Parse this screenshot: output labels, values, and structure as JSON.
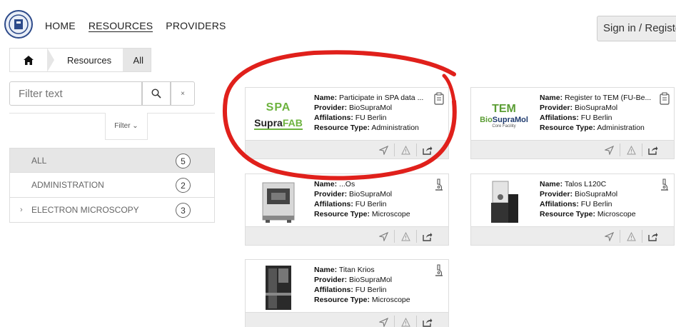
{
  "nav": {
    "items": [
      {
        "label": "HOME",
        "active": false
      },
      {
        "label": "RESOURCES",
        "active": true
      },
      {
        "label": "PROVIDERS",
        "active": false
      }
    ],
    "signin_label": "Sign in / Registe"
  },
  "breadcrumb": {
    "home_icon": "home-icon",
    "items": [
      "Resources",
      "All"
    ]
  },
  "filter": {
    "placeholder": "Filter text",
    "clear_label": "×",
    "tab_label": "Filter ⌄"
  },
  "categories": [
    {
      "label": "ALL",
      "count": "5",
      "expandable": false
    },
    {
      "label": "ADMINISTRATION",
      "count": "2",
      "expandable": false
    },
    {
      "label": "ELECTRON MICROSCOPY",
      "count": "3",
      "expandable": true
    }
  ],
  "labels": {
    "name": "Name:",
    "provider": "Provider:",
    "affiliations": "Affilations:",
    "type": "Resource Type:"
  },
  "cards": [
    {
      "name": "Participate in SPA data ...",
      "provider": "BioSupraMol",
      "affiliations": "FU Berlin",
      "type": "Administration",
      "thumb_top": "SPA",
      "thumb_bottom_a": "Supra",
      "thumb_bottom_b": "FAB",
      "icon": "clipboard-icon"
    },
    {
      "name": "Register to TEM (FU-Be...",
      "provider": "BioSupraMol",
      "affiliations": "FU Berlin",
      "type": "Administration",
      "thumb_top": "TEM",
      "thumb_bottom_a": "Bio",
      "thumb_bottom_b": "SupraMol",
      "thumb_sub": "Core Facility",
      "icon": "clipboard-icon"
    },
    {
      "name": "...Os",
      "provider": "BioSupraMol",
      "affiliations": "FU Berlin",
      "type": "Microscope",
      "icon": "microscope-icon"
    },
    {
      "name": "Talos L120C",
      "provider": "BioSupraMol",
      "affiliations": "FU Berlin",
      "type": "Microscope",
      "icon": "microscope-icon"
    },
    {
      "name": "Titan Krios",
      "provider": "BioSupraMol",
      "affiliations": "FU Berlin",
      "type": "Microscope",
      "icon": "microscope-icon"
    }
  ],
  "colors": {
    "annotation": "#e0201b",
    "accent_green": "#6db33f",
    "footer_bg": "#ececec"
  }
}
